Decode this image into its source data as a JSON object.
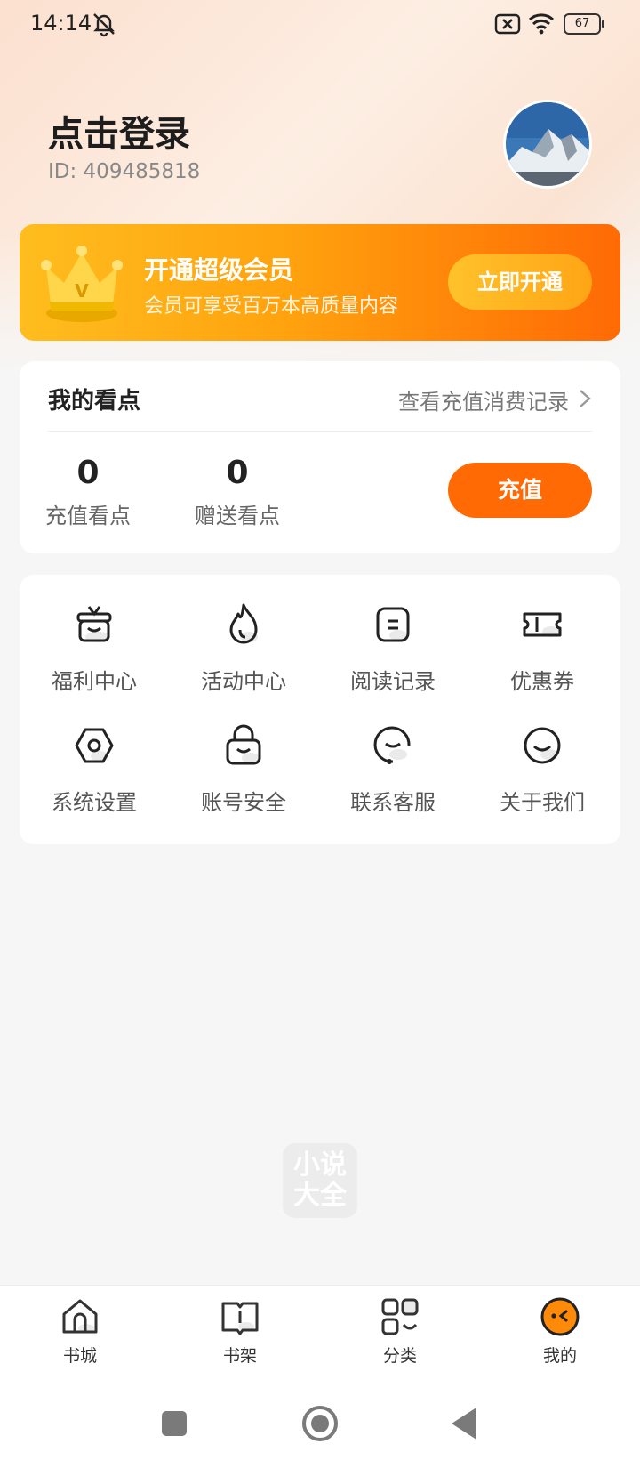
{
  "status_bar": {
    "time": "14:14",
    "battery": "67"
  },
  "profile": {
    "title": "点击登录",
    "id": "ID: 409485818"
  },
  "vip": {
    "title": "开通超级会员",
    "subtitle": "会员可享受百万本高质量内容",
    "button": "立即开通"
  },
  "points": {
    "title": "我的看点",
    "record_link": "查看充值消费记录",
    "stats": [
      {
        "value": "0",
        "label": "充值看点"
      },
      {
        "value": "0",
        "label": "赠送看点"
      }
    ],
    "recharge_button": "充值"
  },
  "menu": {
    "items": [
      {
        "label": "福利中心",
        "icon": "gift-box-icon"
      },
      {
        "label": "活动中心",
        "icon": "flame-icon"
      },
      {
        "label": "阅读记录",
        "icon": "document-icon"
      },
      {
        "label": "优惠券",
        "icon": "ticket-icon"
      },
      {
        "label": "系统设置",
        "icon": "settings-icon"
      },
      {
        "label": "账号安全",
        "icon": "lock-icon"
      },
      {
        "label": "联系客服",
        "icon": "headset-icon"
      },
      {
        "label": "关于我们",
        "icon": "smile-icon"
      }
    ]
  },
  "watermark": {
    "line1": "小说",
    "line2": "大全"
  },
  "bottom_nav": {
    "items": [
      {
        "label": "书城",
        "icon": "home-icon",
        "active": false
      },
      {
        "label": "书架",
        "icon": "bookshelf-icon",
        "active": false
      },
      {
        "label": "分类",
        "icon": "category-icon",
        "active": false
      },
      {
        "label": "我的",
        "icon": "profile-face-icon",
        "active": true
      }
    ]
  },
  "colors": {
    "accent": "#ff6a05",
    "vip_gradient_start": "#ffbd1e",
    "vip_gradient_end": "#ff6a05",
    "background": "#f6f6f6"
  }
}
